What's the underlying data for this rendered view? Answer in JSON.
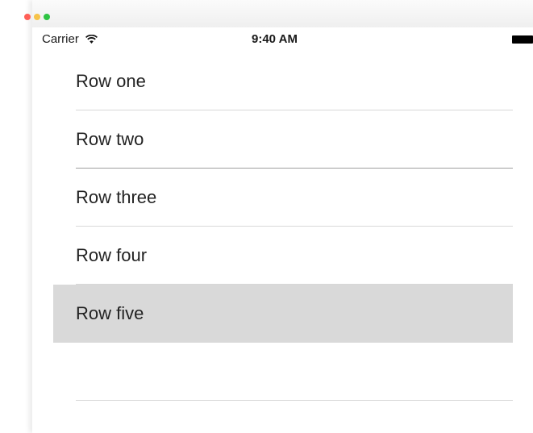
{
  "status_bar": {
    "carrier": "Carrier",
    "time": "9:40 AM"
  },
  "table": {
    "rows": [
      {
        "label": "Row one"
      },
      {
        "label": "Row two"
      },
      {
        "label": "Row three"
      },
      {
        "label": "Row four"
      },
      {
        "label": "Row five",
        "selected": true
      }
    ]
  },
  "colors": {
    "selected_row": "#d9d9d9",
    "separator": "#d8d8d8"
  },
  "icons": {
    "wifi": "wifi-icon",
    "battery": "battery-icon"
  }
}
